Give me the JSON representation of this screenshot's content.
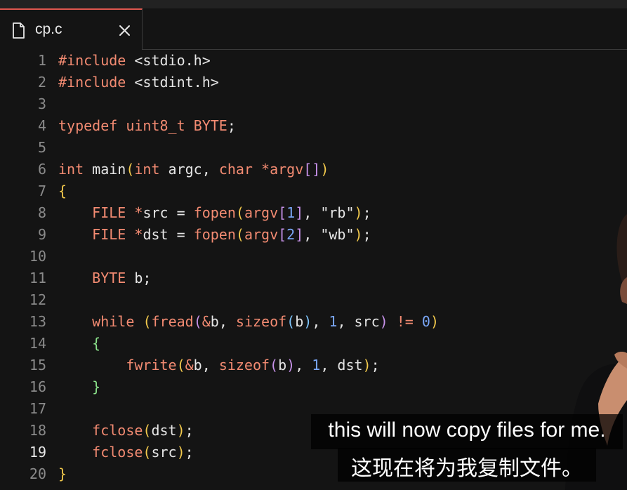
{
  "tab": {
    "title": "cp.c",
    "file_icon": "file-icon",
    "close_icon": "close-icon",
    "accent_color": "#e0574f"
  },
  "editor": {
    "active_line": 19,
    "lines": [
      {
        "n": "1"
      },
      {
        "n": "2"
      },
      {
        "n": "3"
      },
      {
        "n": "4"
      },
      {
        "n": "5"
      },
      {
        "n": "6"
      },
      {
        "n": "7"
      },
      {
        "n": "8"
      },
      {
        "n": "9"
      },
      {
        "n": "10"
      },
      {
        "n": "11"
      },
      {
        "n": "12"
      },
      {
        "n": "13"
      },
      {
        "n": "14"
      },
      {
        "n": "15"
      },
      {
        "n": "16"
      },
      {
        "n": "17"
      },
      {
        "n": "18"
      },
      {
        "n": "19"
      },
      {
        "n": "20"
      }
    ],
    "tokens": {
      "l1": [
        "#include",
        " <stdio.h>"
      ],
      "l2": [
        "#include",
        " <stdint.h>"
      ],
      "l4": [
        "typedef",
        " ",
        "uint8_t",
        " ",
        "BYTE",
        ";"
      ],
      "l6": [
        "int",
        " main",
        "(",
        "int",
        " argc, ",
        "char",
        " ",
        "*",
        "argv",
        "[]",
        ")"
      ],
      "l7": [
        "{"
      ],
      "l8": [
        "    ",
        "FILE",
        " ",
        "*",
        "src = ",
        "fopen",
        "(",
        "argv",
        "[",
        "1",
        "]",
        ", \"rb\"",
        ")",
        ";"
      ],
      "l9": [
        "    ",
        "FILE",
        " ",
        "*",
        "dst = ",
        "fopen",
        "(",
        "argv",
        "[",
        "2",
        "]",
        ", \"wb\"",
        ")",
        ";"
      ],
      "l11": [
        "    ",
        "BYTE",
        " b;"
      ],
      "l13": [
        "    ",
        "while",
        " ",
        "(",
        "fread",
        "(",
        "&",
        "b, ",
        "sizeof",
        "(",
        "b",
        ")",
        ", ",
        "1",
        ", src",
        ")",
        " ",
        "!=",
        " ",
        "0",
        ")"
      ],
      "l14": [
        "    ",
        "{"
      ],
      "l15": [
        "        ",
        "fwrite",
        "(",
        "&",
        "b, ",
        "sizeof",
        "(",
        "b",
        ")",
        ", ",
        "1",
        ", dst",
        ")",
        ";"
      ],
      "l16": [
        "    ",
        "}"
      ],
      "l18": [
        "    ",
        "fclose",
        "(",
        "dst",
        ")",
        ";"
      ],
      "l19": [
        "    ",
        "fclose",
        "(",
        "src",
        ")",
        ";"
      ],
      "l20": [
        "}"
      ]
    }
  },
  "caption": {
    "english": "this will now copy files for me.",
    "chinese": "这现在将为我复制文件。"
  }
}
